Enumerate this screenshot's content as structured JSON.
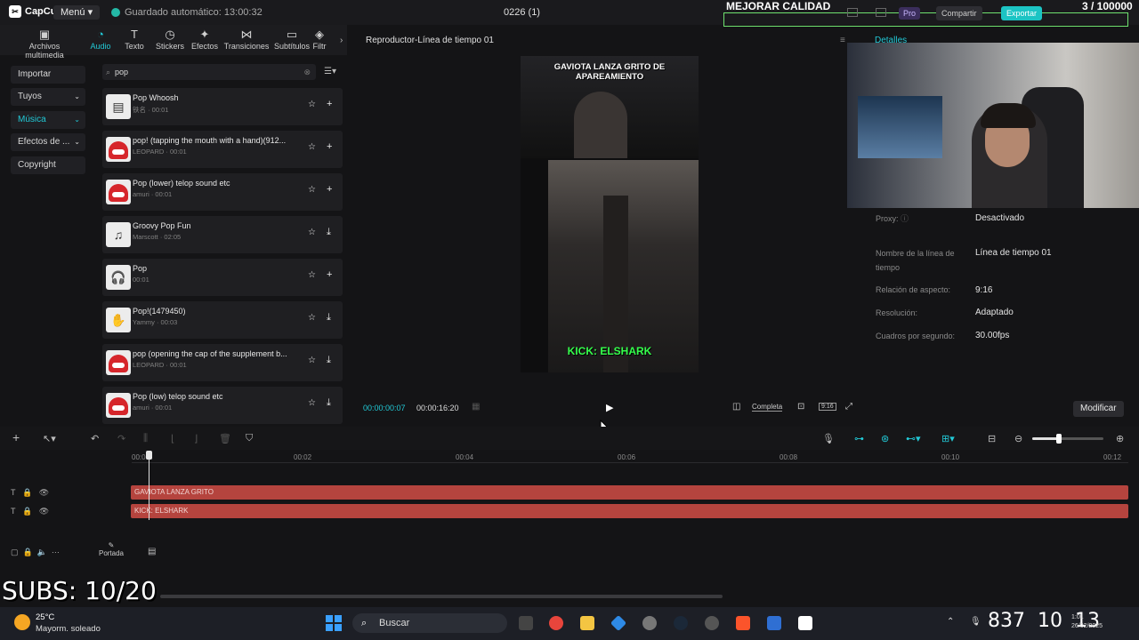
{
  "titlebar": {
    "app_name": "CapCut",
    "menu_label": "Menú",
    "autosave": "Guardado automático: 13:00:32",
    "project": "0226 (1)",
    "overlay_quality": "MEJORAR CALIDAD",
    "overlay_counter": "3 / 100000",
    "pro_label": "Pro",
    "share_label": "Compartir",
    "export_label": "Exportar"
  },
  "toolbar": {
    "items": [
      {
        "label": "Archivos multimedia",
        "icon": "media-icon"
      },
      {
        "label": "Audio",
        "icon": "audio-icon"
      },
      {
        "label": "Texto",
        "icon": "text-icon"
      },
      {
        "label": "Stickers",
        "icon": "sticker-icon"
      },
      {
        "label": "Efectos",
        "icon": "effects-icon"
      },
      {
        "label": "Transiciones",
        "icon": "transition-icon"
      },
      {
        "label": "Subtítulos",
        "icon": "subtitles-icon"
      },
      {
        "label": "Filtr",
        "icon": "filter-icon"
      }
    ],
    "active": "Audio"
  },
  "sidenav": {
    "items": [
      {
        "label": "Importar"
      },
      {
        "label": "Tuyos"
      },
      {
        "label": "Música"
      },
      {
        "label": "Efectos de ..."
      },
      {
        "label": "Copyright"
      }
    ]
  },
  "search": {
    "value": "pop"
  },
  "audio_list": [
    {
      "title": "Pop Whoosh",
      "sub": "铁名 · 00:01",
      "thumb": "whoosh",
      "action": "add"
    },
    {
      "title": "pop! (tapping the mouth with a hand)(912...",
      "sub": "LEOPARD · 00:01",
      "thumb": "red",
      "action": "add"
    },
    {
      "title": "Pop (lower) telop sound etc",
      "sub": "amuri · 00:01",
      "thumb": "red",
      "action": "add"
    },
    {
      "title": "Groovy Pop Fun",
      "sub": "Marscott · 02:05",
      "thumb": "groovy",
      "action": "download"
    },
    {
      "title": "Pop",
      "sub": "00:01",
      "thumb": "headphones",
      "action": "add"
    },
    {
      "title": "Pop!(1479450)",
      "sub": "Yammy · 00:03",
      "thumb": "hand",
      "action": "download"
    },
    {
      "title": "pop (opening the cap of the supplement b...",
      "sub": "LEOPARD · 00:01",
      "thumb": "red",
      "action": "download"
    },
    {
      "title": "Pop (low) telop sound etc",
      "sub": "amuri · 00:01",
      "thumb": "red",
      "action": "download"
    }
  ],
  "player": {
    "title": "Reproductor-Línea de tiempo 01",
    "caption_top": "GAVIOTA LANZA GRITO DE APAREAMIENTO",
    "caption_bottom": "KICK: ELSHARK",
    "time_current": "00:00:00:07",
    "time_total": "00:00:16:20",
    "completa": "Completa",
    "ratio": "9:16"
  },
  "details": {
    "tab": "Detalles",
    "rows": [
      {
        "label": "Proxy:",
        "value": "Desactivado"
      },
      {
        "label": "Nombre de la línea de tiempo",
        "value": "Línea de tiempo 01"
      },
      {
        "label": "Relación de aspecto:",
        "value": "9:16"
      },
      {
        "label": "Resolución:",
        "value": "Adaptado"
      },
      {
        "label": "Cuadros por segundo:",
        "value": "30.00fps"
      }
    ],
    "modify_label": "Modificar"
  },
  "timeline": {
    "ticks": [
      "00:00",
      "00:02",
      "00:04",
      "00:06",
      "00:08",
      "00:10",
      "00:12"
    ],
    "clips": [
      "GAVIOTA LANZA GRITO",
      "KICK: ELSHARK"
    ],
    "cover_label": "Portada",
    "zoom_level": 0.37
  },
  "overlay": {
    "subs": "SUBS: 10/20"
  },
  "taskbar": {
    "temp": "25°C",
    "weather": "Mayorm. soleado",
    "search": "Buscar",
    "clock_hours": "8",
    "clock_minutes": "37",
    "clock_seconds": "10",
    "clock_extra": "13",
    "clock_time": "1:01",
    "clock_date": "26/02/2025"
  }
}
